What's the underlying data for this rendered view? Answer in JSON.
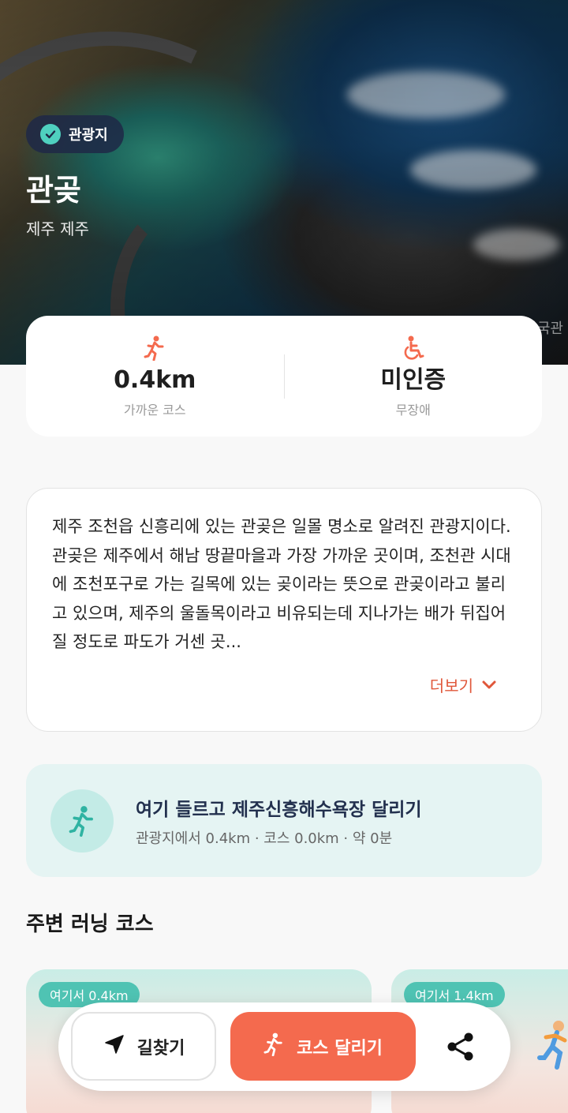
{
  "hero": {
    "badge": "관광지",
    "title": "관곶",
    "region": "제주 제주",
    "watermark": "한국관"
  },
  "stats": [
    {
      "icon": "walking-person-icon",
      "value": "0.4km",
      "label": "가까운 코스"
    },
    {
      "icon": "wheelchair-icon",
      "value": "미인증",
      "label": "무장애"
    }
  ],
  "description": {
    "text": "제주 조천읍 신흥리에 있는 관곶은 일몰 명소로 알려진 관광지이다. 관곶은 제주에서 해남 땅끝마을과 가장 가까운 곳이며, 조천관 시대에 조천포구로 가는 길목에 있는 곶이라는 뜻으로 관곶이라고 불리고 있으며, 제주의 울돌목이라고 비유되는데 지나가는 배가 뒤집어질 정도로 파도가 거센 곳...",
    "more_label": "더보기"
  },
  "run_banner": {
    "title": "여기 들르고 제주신흥해수욕장 달리기",
    "subtitle": "관광지에서 0.4km · 코스 0.0km · 약 0분"
  },
  "nearby": {
    "section_title": "주변 러닝 코스",
    "courses": [
      {
        "distance_tag": "여기서 0.4km"
      },
      {
        "distance_tag": "여기서 1.4km"
      }
    ]
  },
  "actions": {
    "navigate_label": "길찾기",
    "run_label": "코스 달리기",
    "share_icon": "share-icon"
  },
  "colors": {
    "accent": "#f46a4e",
    "teal": "#4fc3b3",
    "banner_bg": "#e5f4f3",
    "badge_bg": "#1e2846"
  }
}
